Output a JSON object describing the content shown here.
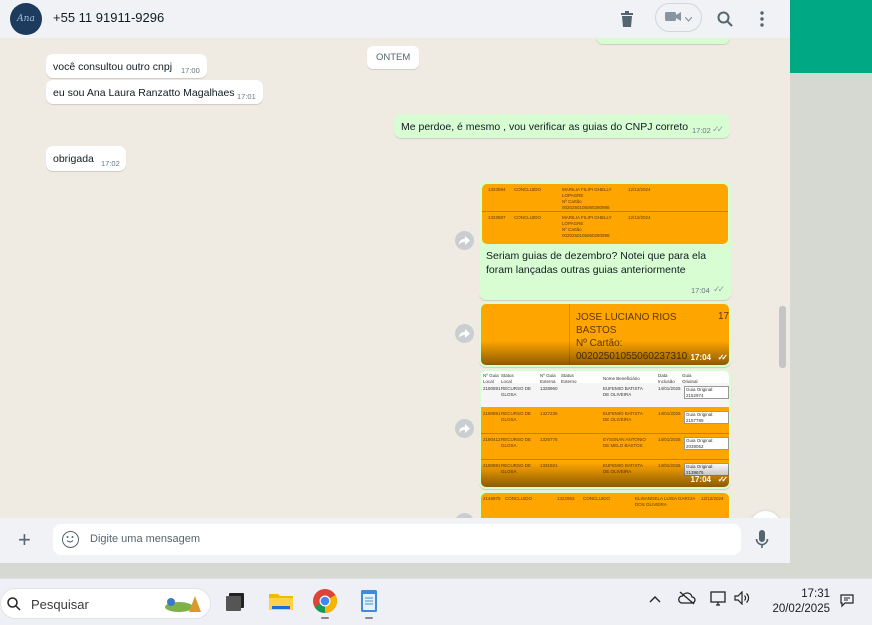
{
  "header": {
    "avatar_text": "Ana",
    "contact_number": "+55 11 91911-9296",
    "icons": [
      "trash-icon",
      "video-call-icon",
      "search-icon",
      "more-options-icon"
    ]
  },
  "chat": {
    "date_chip": "ONTEM",
    "messages": [
      {
        "dir": "in",
        "text": "você consultou outro cnpj",
        "time": "17:00"
      },
      {
        "dir": "in",
        "text": "eu sou Ana Laura Ranzatto Magalhaes",
        "time": "17:01"
      },
      {
        "dir": "out",
        "text": "Me perdoe, é mesmo , vou verificar as guias do CNPJ correto",
        "time": "17:02"
      },
      {
        "dir": "in",
        "text": "obrigada",
        "time": "17:02"
      },
      {
        "dir": "out",
        "caption_line1": "Seriam guias de dezembro? Notei que para ela",
        "caption_line2": "foram lançadas outras guias anteriormente",
        "time": "17:04"
      },
      {
        "dir": "out",
        "image_name": "JOSE LUCIANO RIOS",
        "image_name2": "BASTOS",
        "image_card_label": "Nº Cartão:",
        "image_card_number": "00202501055060237310",
        "image_edge": "17",
        "time": "17:04"
      },
      {
        "dir": "out",
        "time": "17:04"
      }
    ],
    "image1_rows": [
      {
        "col1": "1323594",
        "col2": "CONCLUIDO",
        "col3": "MARILIA FILIPI GHELLY LOPAGRE",
        "col4": "Nº Cartão 0020250105060280998",
        "col5": "12/12/2024"
      },
      {
        "col1": "1323597",
        "col2": "CONCLUIDO",
        "col3": "MARILIA FILIPI GHELLY LOPAGRE",
        "col4": "Nº Cartão 0020250105060280998",
        "col5": "12/12/2024"
      }
    ],
    "image3_headers": [
      "Nº Guia Local",
      "Status Local",
      "Nº Guia Externa",
      "Status Externo",
      "Nome Beneficiário",
      "Data Inclusão",
      "Guia Original"
    ],
    "image3_rows": [
      {
        "guia": "2180891",
        "status": "RECURSO DE GLOSA",
        "ext": "1328960",
        "nome": "EUFEMIO BATISTA DE OLIVEIRA",
        "data": "14/01/2025",
        "original": "Guia Original: 2152974"
      },
      {
        "guia": "2180891",
        "status": "RECURSO DE GLOSA",
        "ext": "1327230",
        "nome": "EUFEMIO BATISTA DE OLIVEIRA",
        "data": "14/01/2025",
        "original": "Guia Original: 2157789"
      },
      {
        "guia": "2180412",
        "status": "RECURSO DE GLOSA",
        "ext": "1326778",
        "nome": "EYSSNAN ANTONIO DE MELO BASTOS",
        "data": "14/01/2025",
        "original": "Guia Original: 2039052"
      },
      {
        "guia": "2180891",
        "status": "RECURSO DE GLOSA",
        "ext": "1331921",
        "nome": "EUFEMIO BATISTA DE OLIVEIRA",
        "data": "14/01/2025",
        "original": "Guia Original: 2139675"
      }
    ],
    "image4_row": {
      "col1": "2148975",
      "col2": "CONCLUIDO",
      "col3": "1322963",
      "col4": "CONCLUIDO",
      "col5": "ELISANGELA LUISA GARCIA DOS OLIVEIRA",
      "col6": "12/12/2024"
    }
  },
  "composer": {
    "placeholder": "Digite uma mensagem"
  },
  "taskbar": {
    "search_placeholder": "Pesquisar",
    "time": "17:31",
    "date": "20/02/2025"
  },
  "colors": {
    "accent": "#00a884",
    "outgoing": "#d9fdd3",
    "image_bg": "#fea500"
  }
}
